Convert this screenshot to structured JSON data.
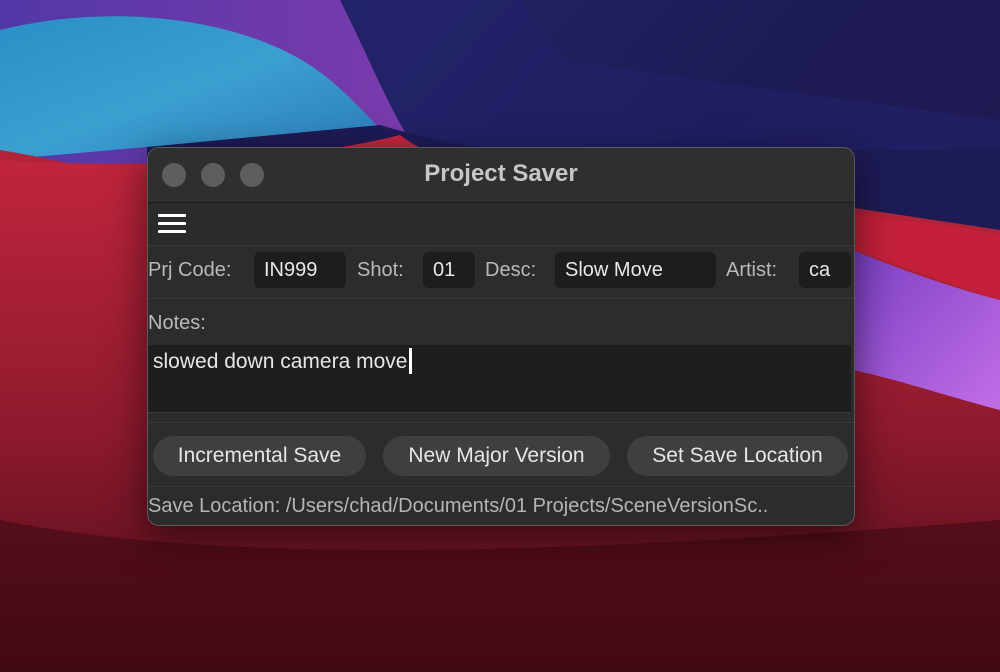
{
  "window": {
    "title": "Project Saver",
    "traffic_lights": [
      "close",
      "minimize",
      "zoom"
    ]
  },
  "menu": {
    "icon": "hamburger-menu-icon"
  },
  "fields": {
    "prj_code": {
      "label": "Prj Code:",
      "value": "IN999"
    },
    "shot": {
      "label": "Shot:",
      "value": "01"
    },
    "desc": {
      "label": "Desc:",
      "value": "Slow Move"
    },
    "artist": {
      "label": "Artist:",
      "value": "ca"
    }
  },
  "notes": {
    "label": "Notes:",
    "value": "slowed down camera move"
  },
  "buttons": {
    "incremental_save": "Incremental Save",
    "new_major_version": "New Major Version",
    "set_save_location": "Set Save Location"
  },
  "status": {
    "text": "Save Location: /Users/chad/Documents/01 Projects/SceneVersionSc.."
  },
  "colors": {
    "window_bg": "#2c2c2c",
    "input_bg": "#1d1d1d",
    "button_bg": "#3f3f3f",
    "traffic_inactive": "#5e5e5e"
  }
}
